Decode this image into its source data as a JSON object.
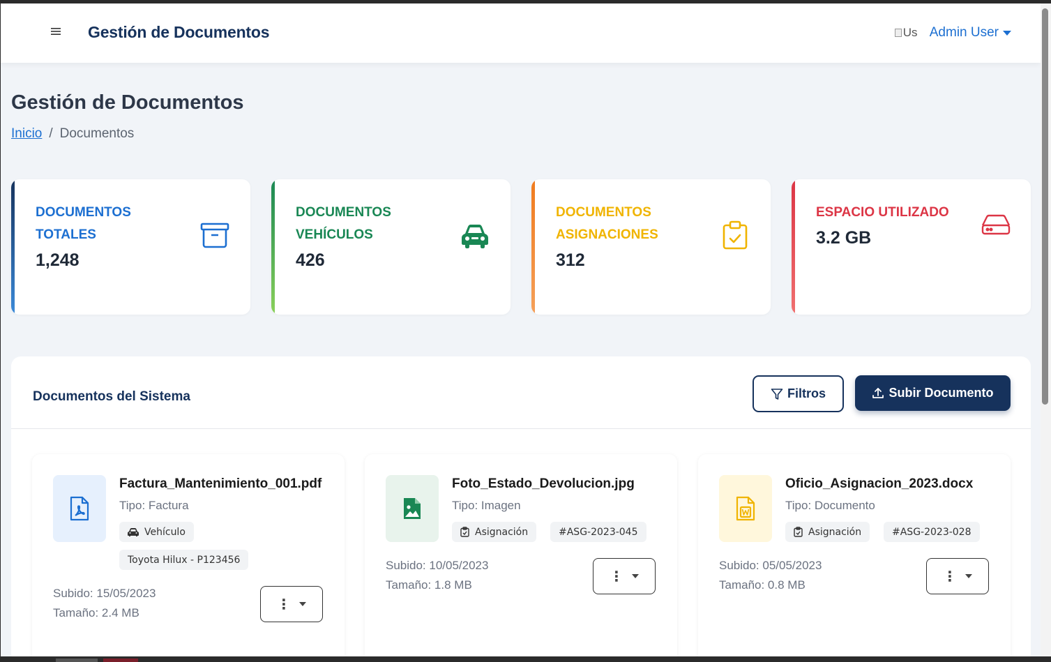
{
  "topbar": {
    "menu_icon": "hamburger-icon",
    "brand": "Gestión de Documentos",
    "avatar_alt": "Us",
    "user_name": "Admin User"
  },
  "page": {
    "title": "Gestión de Documentos",
    "breadcrumb": {
      "home": "Inicio",
      "separator": "/",
      "current": "Documentos"
    }
  },
  "stats": [
    {
      "label": "Documentos Totales",
      "value": "1,248",
      "icon": "archive-box-icon",
      "color": "#1c6fd1"
    },
    {
      "label": "Documentos Vehículos",
      "value": "426",
      "icon": "car-icon",
      "color": "#198754"
    },
    {
      "label": "Documentos Asignaciones",
      "value": "312",
      "icon": "clipboard-check-icon",
      "color": "#f0b400"
    },
    {
      "label": "Espacio Utilizado",
      "value": "3.2 GB",
      "icon": "hard-drive-icon",
      "color": "#dc3545"
    }
  ],
  "panel": {
    "title": "Documentos del Sistema",
    "filter_label": "Filtros",
    "upload_label": "Subir Documento"
  },
  "documents": [
    {
      "name": "Factura_Mantenimiento_001.pdf",
      "type": "Tipo: Factura",
      "icon": "pdf-file-icon",
      "tags": [
        "Vehículo",
        "Toyota Hilux - P123456"
      ],
      "uploaded": "Subido: 15/05/2023",
      "size": "Tamaño: 2.4 MB"
    },
    {
      "name": "Foto_Estado_Devolucion.jpg",
      "type": "Tipo: Imagen",
      "icon": "image-file-icon",
      "tags": [
        "Asignación",
        "#ASG-2023-045"
      ],
      "uploaded": "Subido: 10/05/2023",
      "size": "Tamaño: 1.8 MB"
    },
    {
      "name": "Oficio_Asignacion_2023.docx",
      "type": "Tipo: Documento",
      "icon": "word-file-icon",
      "tags": [
        "Asignación",
        "#ASG-2023-028"
      ],
      "uploaded": "Subido: 05/05/2023",
      "size": "Tamaño: 0.8 MB"
    }
  ],
  "colors": {
    "primary": "#16325c",
    "link": "#1c6fd1",
    "background": "#f1f4f8"
  }
}
